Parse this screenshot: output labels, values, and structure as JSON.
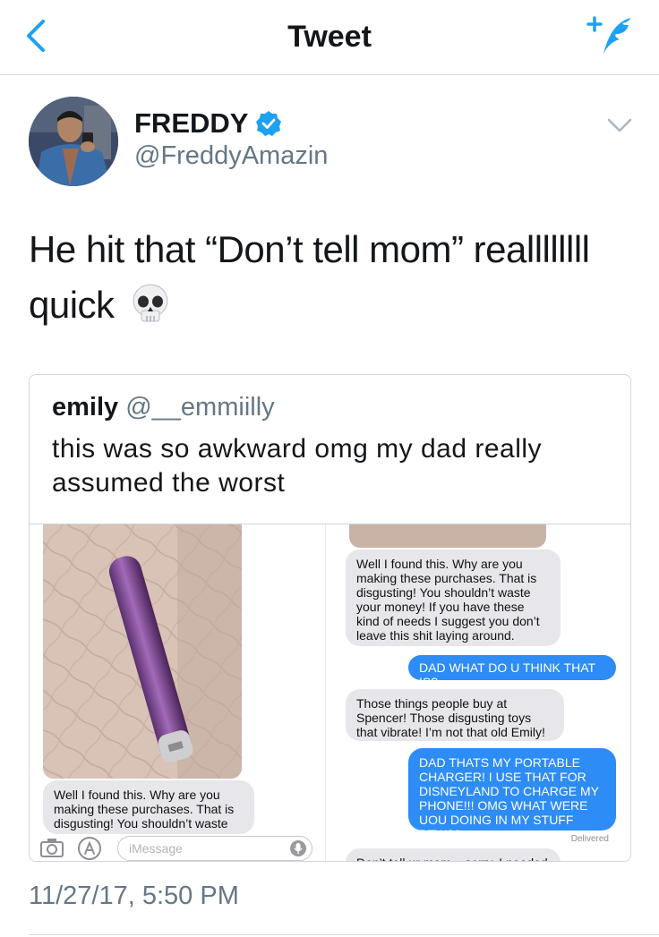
{
  "nav": {
    "title": "Tweet",
    "accent_color": "#1da1f2",
    "back_icon": "chevron-left-icon",
    "compose_icon": "compose-tweet-icon"
  },
  "author": {
    "name": "FREDDY",
    "handle": "@FreddyAmazin",
    "verified": true,
    "verified_icon": "verified-badge-icon"
  },
  "tweet": {
    "text": "He hit that “Don’t tell mom” reallllllll quick",
    "emoji": "skull-emoji",
    "timestamp": "11/27/17, 5:50 PM"
  },
  "quote": {
    "name": "emily",
    "handle": "@__emmiilly",
    "text": "this was so awkward omg my dad really assumed the worst",
    "media": {
      "left": {
        "bubble": "Well I found this. Why are you making these purchases. That is disgusting! You shouldn’t waste",
        "input_placeholder": "iMessage"
      },
      "right": {
        "messages": [
          {
            "from": "dad",
            "text": "Well I found this. Why are you making these purchases. That is disgusting! You shouldn’t waste your money! If you have these kind of needs I suggest you don’t leave this shit laying around."
          },
          {
            "from": "me",
            "text": "DAD WHAT DO U THINK THAT IS?"
          },
          {
            "from": "dad",
            "text": "Those things people buy at Spencer! Those disgusting toys that vibrate! I’m not that old Emily!"
          },
          {
            "from": "me",
            "text": "DAD THATS MY PORTABLE CHARGER! I USE THAT FOR DISNEYLAND TO CHARGE MY PHONE!!! OMG WHAT WERE UOU DOING IN MY STUFF BTW??"
          },
          {
            "from": "dad",
            "text": "Don’t tell ur mom... sorry, I needed"
          }
        ],
        "delivered": "Delivered"
      }
    }
  }
}
